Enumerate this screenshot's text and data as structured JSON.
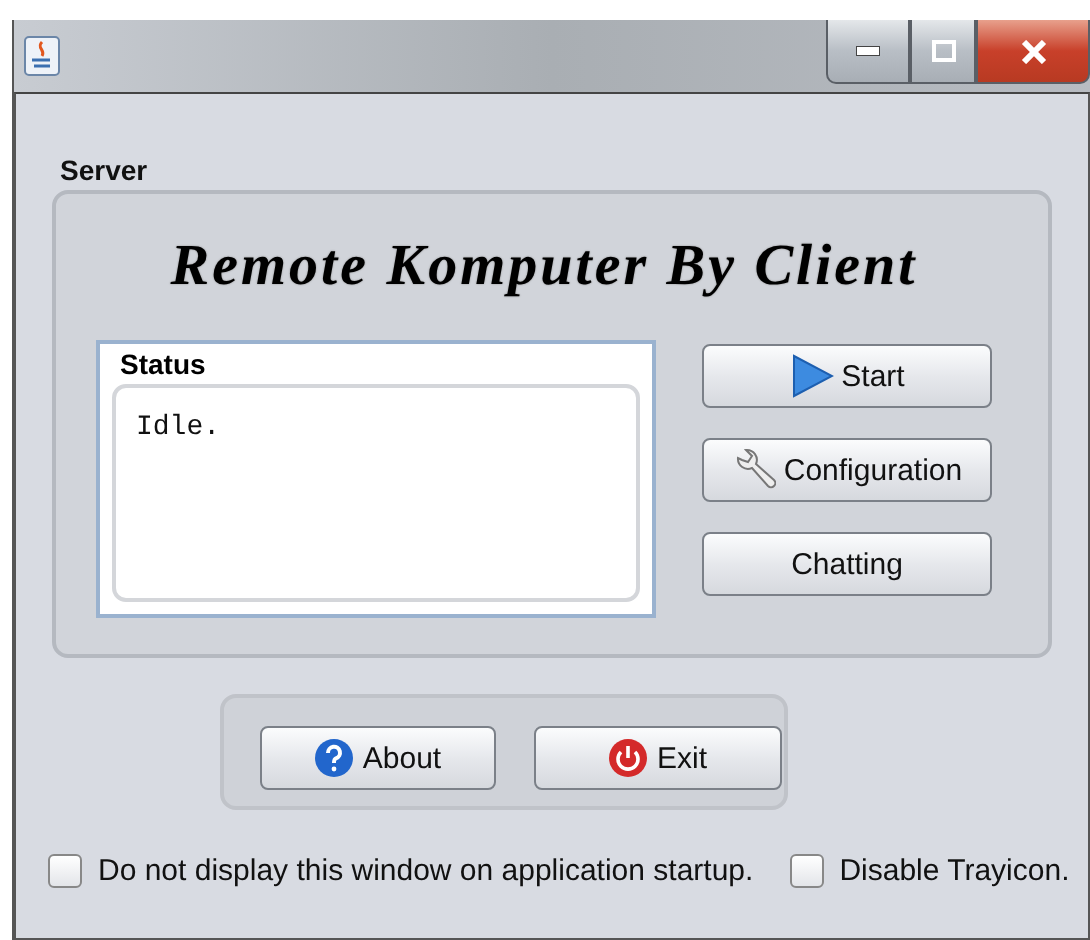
{
  "server": {
    "label": "Server",
    "heading": "Remote Komputer By Client",
    "status": {
      "label": "Status",
      "text": "Idle."
    },
    "buttons": [
      {
        "label": "Start"
      },
      {
        "label": "Configuration"
      },
      {
        "label": "Chatting"
      }
    ]
  },
  "bottom_buttons": [
    {
      "label": "About"
    },
    {
      "label": "Exit"
    }
  ],
  "options": [
    {
      "label": "Do not display this window on application startup.",
      "checked": false
    },
    {
      "label": "Disable Trayicon.",
      "checked": false
    }
  ]
}
